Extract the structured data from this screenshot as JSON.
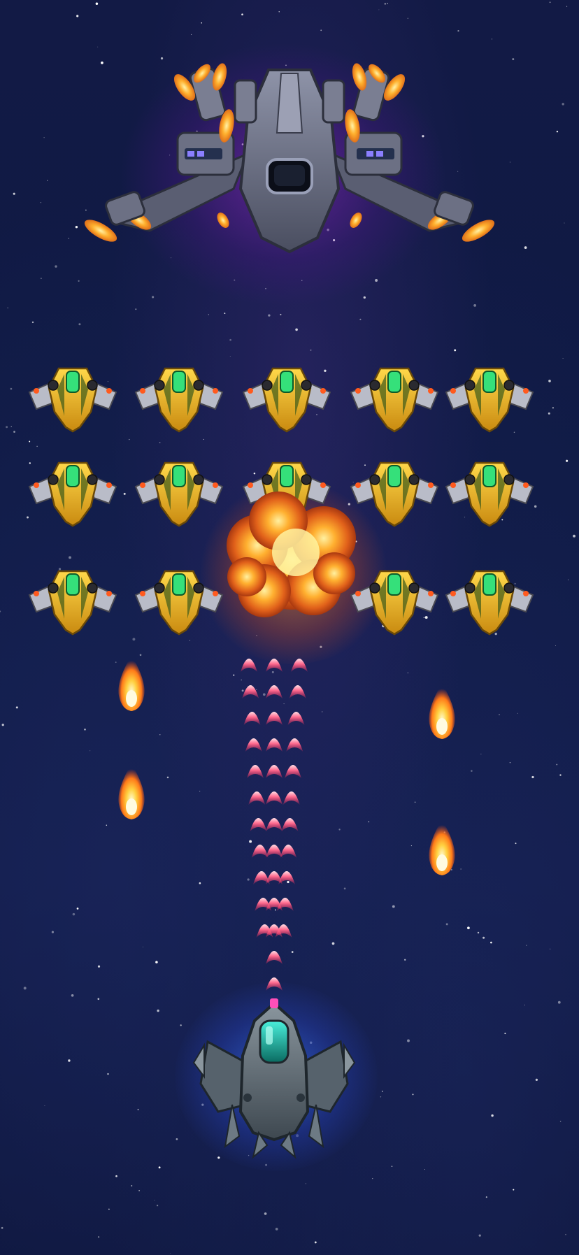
{
  "scene": {
    "colors": {
      "background": "#121a45",
      "boss_hull": "#6b6f82",
      "boss_glow": "#9b2fd0",
      "boss_thruster": "#ffb02e",
      "enemy_body": "#e8b21e",
      "enemy_cockpit": "#35e07a",
      "enemy_eye": "#ff5a1e",
      "player_hull": "#6d7a84",
      "player_cockpit": "#19b8a6",
      "player_glow": "#3c78ff",
      "laser": "#ff4f7a",
      "fireball": "#ff8a1e",
      "explosion": "#ff9a20"
    }
  },
  "boss": {
    "icon": "boss-warship-icon"
  },
  "enemy_grid": {
    "rows": 3,
    "columns": 5,
    "icon": "enemy-fighter-icon",
    "destroyed": [
      {
        "row": 3,
        "column": 3
      }
    ]
  },
  "explosion": {
    "icon": "explosion-icon"
  },
  "player": {
    "icon": "player-ship-icon"
  },
  "player_laser": {
    "icon": "laser-stream-icon",
    "streams": 3,
    "bolts_per_stream": 14
  },
  "enemy_fireballs": {
    "icon": "fireball-icon",
    "count": 4
  }
}
